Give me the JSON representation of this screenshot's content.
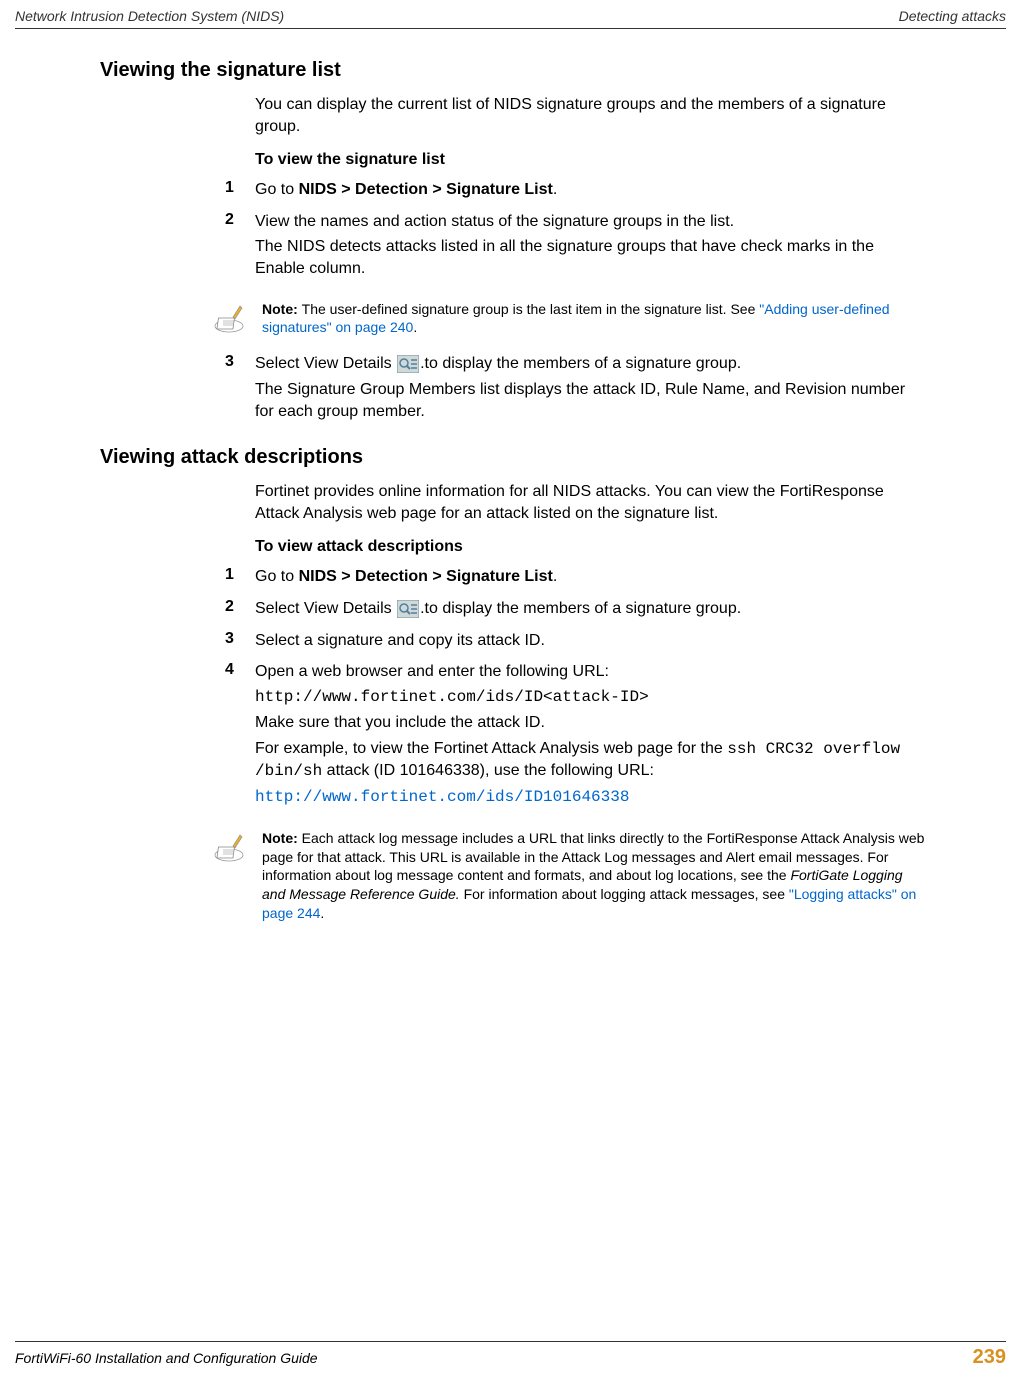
{
  "header": {
    "left": "Network Intrusion Detection System (NIDS)",
    "right": "Detecting attacks"
  },
  "section1": {
    "heading": "Viewing the signature list",
    "intro": "You can display the current list of NIDS signature groups and the members of a signature group.",
    "subheading": "To view the signature list",
    "steps": {
      "s1": {
        "num": "1",
        "pre": "Go to ",
        "bold": "NIDS > Detection > Signature List",
        "post": "."
      },
      "s2": {
        "num": "2",
        "line1": "View the names and action status of the signature groups in the list.",
        "line2": "The NIDS detects attacks listed in all the signature groups that have check marks in the Enable column."
      },
      "s3": {
        "num": "3",
        "line1a": "Select View Details ",
        "line1b": ".to display the members of a signature group.",
        "line2": "The Signature Group Members list displays the attack ID, Rule Name, and Revision number for each group member."
      }
    },
    "note": {
      "label": "Note: ",
      "text1": "The user-defined signature group is the last item in the signature list. See ",
      "link": "\"Adding user-defined signatures\" on page 240",
      "text2": "."
    }
  },
  "section2": {
    "heading": "Viewing attack descriptions",
    "intro": "Fortinet provides online information for all NIDS attacks. You can view the FortiResponse Attack Analysis web page for an attack listed on the signature list.",
    "subheading": "To view attack descriptions",
    "steps": {
      "s1": {
        "num": "1",
        "pre": "Go to ",
        "bold": "NIDS > Detection > Signature List",
        "post": "."
      },
      "s2": {
        "num": "2",
        "line1a": "Select View Details ",
        "line1b": ".to display the members of a signature group."
      },
      "s3": {
        "num": "3",
        "text": "Select a signature and copy its attack ID."
      },
      "s4": {
        "num": "4",
        "line1": "Open a web browser and enter the following URL:",
        "url1": "http://www.fortinet.com/ids/ID<attack-ID>",
        "line2": "Make sure that you include the attack ID.",
        "line3a": "For example, to view the Fortinet Attack Analysis web page for the ",
        "mono1": "ssh CRC32 overflow /bin/sh",
        "line3b": " attack (ID 101646338), use the following URL:",
        "url2": "http://www.fortinet.com/ids/ID101646338"
      }
    },
    "note": {
      "label": "Note: ",
      "text1": "Each attack log message includes a URL that links directly to the FortiResponse Attack Analysis web page for that attack. This URL is available in the Attack Log messages and Alert email messages. For information about log message content and formats, and about log locations, see the ",
      "italic": "FortiGate Logging and Message Reference Guide.",
      "text2": " For information about logging attack messages, see ",
      "link": "\"Logging attacks\" on page 244",
      "text3": "."
    }
  },
  "footer": {
    "title": "FortiWiFi-60 Installation and Configuration Guide",
    "page": "239"
  }
}
